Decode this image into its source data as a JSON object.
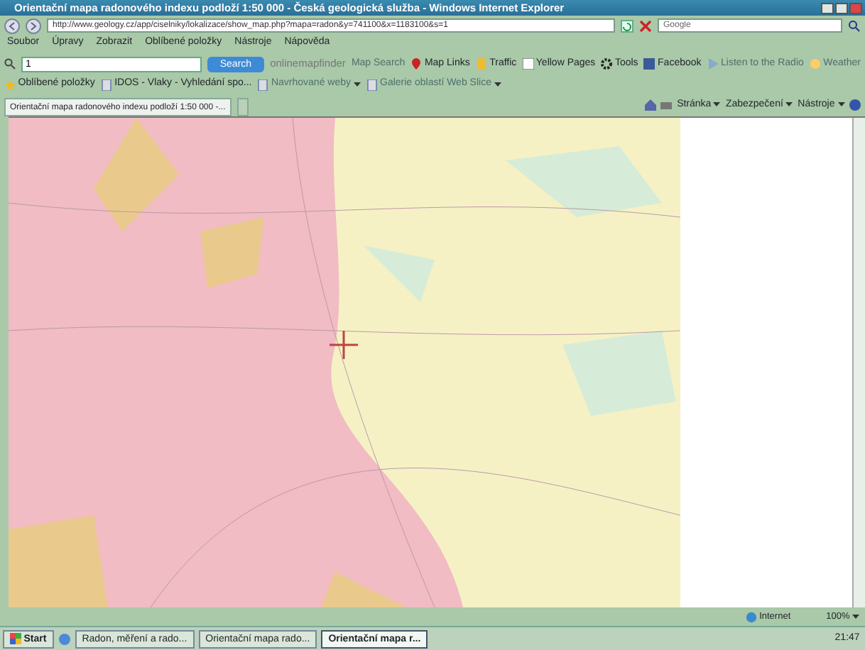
{
  "window": {
    "title": "Orientační mapa radonového indexu podloží 1:50 000 - Česká geologická služba - Windows Internet Explorer"
  },
  "address_bar": {
    "url": "http://www.geology.cz/app/ciselniky/lokalizace/show_map.php?mapa=radon&y=741100&x=1183100&s=1",
    "search_placeholder": "Google"
  },
  "menu": [
    "Soubor",
    "Úpravy",
    "Zobrazit",
    "Oblíbené položky",
    "Nástroje",
    "Nápověda"
  ],
  "toolbar": {
    "search_value": "1",
    "search_button": "Search",
    "brand": "onlinemapfinder",
    "items": [
      {
        "label": "Map Search",
        "disabled": true,
        "kind": "text"
      },
      {
        "label": "Map Links",
        "disabled": false,
        "kind": "pin"
      },
      {
        "label": "Traffic",
        "disabled": false,
        "kind": "light"
      },
      {
        "label": "Yellow Pages",
        "disabled": false,
        "kind": "yp"
      },
      {
        "label": "Tools",
        "disabled": false,
        "kind": "gear"
      },
      {
        "label": "Facebook",
        "disabled": false,
        "kind": "fb"
      },
      {
        "label": "Listen to the Radio",
        "disabled": true,
        "kind": "play"
      },
      {
        "label": "Weather",
        "disabled": true,
        "kind": "sun"
      }
    ]
  },
  "favorites_bar": [
    {
      "label": "Oblíbené položky",
      "disabled": false
    },
    {
      "label": "IDOS - Vlaky - Vyhledání spo...",
      "disabled": false
    },
    {
      "label": "Navrhované weby",
      "disabled": true
    },
    {
      "label": "Galerie oblastí Web Slice",
      "disabled": true
    }
  ],
  "tabs": [
    {
      "label": "Orientační mapa radonového indexu podloží 1:50 000 -...",
      "selected": true
    }
  ],
  "command_bar": [
    "Stránka",
    "Zabezpečení",
    "Nástroje"
  ],
  "status_bar": {
    "zone": "Internet",
    "zoom": "100%"
  },
  "taskbar": {
    "start": "Start",
    "tasks": [
      {
        "label": "Radon, měření a rado...",
        "selected": false
      },
      {
        "label": "Orientační mapa rado...",
        "selected": false
      },
      {
        "label": "Orientační mapa r...",
        "selected": true
      }
    ],
    "clock": "21:47"
  }
}
